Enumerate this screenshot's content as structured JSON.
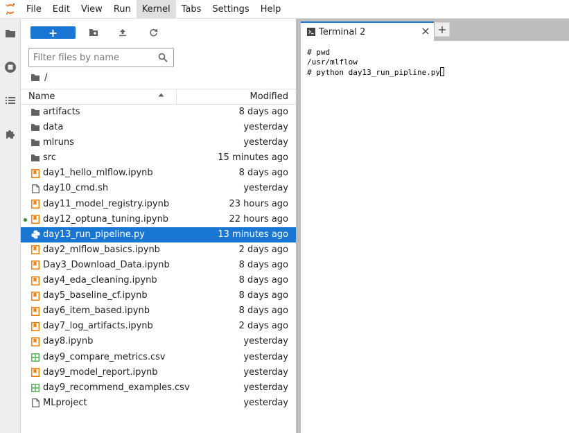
{
  "menubar": {
    "items": [
      "File",
      "Edit",
      "View",
      "Run",
      "Kernel",
      "Tabs",
      "Settings",
      "Help"
    ],
    "active": "Kernel"
  },
  "filebrowser": {
    "new_label": "+",
    "filter_placeholder": "Filter files by name",
    "breadcrumb": "/",
    "header": {
      "name": "Name",
      "modified": "Modified"
    },
    "files": [
      {
        "name": "artifacts",
        "modified": "8 days ago",
        "type": "folder"
      },
      {
        "name": "data",
        "modified": "yesterday",
        "type": "folder"
      },
      {
        "name": "mlruns",
        "modified": "yesterday",
        "type": "folder"
      },
      {
        "name": "src",
        "modified": "15 minutes ago",
        "type": "folder"
      },
      {
        "name": "day1_hello_mlflow.ipynb",
        "modified": "8 days ago",
        "type": "notebook"
      },
      {
        "name": "day10_cmd.sh",
        "modified": "yesterday",
        "type": "file"
      },
      {
        "name": "day11_model_registry.ipynb",
        "modified": "23 hours ago",
        "type": "notebook"
      },
      {
        "name": "day12_optuna_tuning.ipynb",
        "modified": "22 hours ago",
        "type": "notebook",
        "running": true
      },
      {
        "name": "day13_run_pipeline.py",
        "modified": "13 minutes ago",
        "type": "python",
        "selected": true
      },
      {
        "name": "day2_mlflow_basics.ipynb",
        "modified": "2 days ago",
        "type": "notebook"
      },
      {
        "name": "Day3_Download_Data.ipynb",
        "modified": "8 days ago",
        "type": "notebook"
      },
      {
        "name": "day4_eda_cleaning.ipynb",
        "modified": "8 days ago",
        "type": "notebook"
      },
      {
        "name": "day5_baseline_cf.ipynb",
        "modified": "8 days ago",
        "type": "notebook"
      },
      {
        "name": "day6_item_based.ipynb",
        "modified": "8 days ago",
        "type": "notebook"
      },
      {
        "name": "day7_log_artifacts.ipynb",
        "modified": "2 days ago",
        "type": "notebook"
      },
      {
        "name": "day8.ipynb",
        "modified": "yesterday",
        "type": "notebook"
      },
      {
        "name": "day9_compare_metrics.csv",
        "modified": "yesterday",
        "type": "csv"
      },
      {
        "name": "day9_model_report.ipynb",
        "modified": "yesterday",
        "type": "notebook"
      },
      {
        "name": "day9_recommend_examples.csv",
        "modified": "yesterday",
        "type": "csv"
      },
      {
        "name": "MLproject",
        "modified": "yesterday",
        "type": "file"
      }
    ]
  },
  "tabs": [
    {
      "label": "Terminal 2",
      "icon": "terminal-icon"
    }
  ],
  "terminal": {
    "lines": [
      "# pwd",
      "/usr/mlflow",
      "# python day13_run_pipline.py"
    ]
  },
  "colors": {
    "accent": "#1976d2",
    "notebook": "#f57c00",
    "csv": "#4caf50",
    "running": "#388e3c",
    "python": "#ffffff"
  }
}
